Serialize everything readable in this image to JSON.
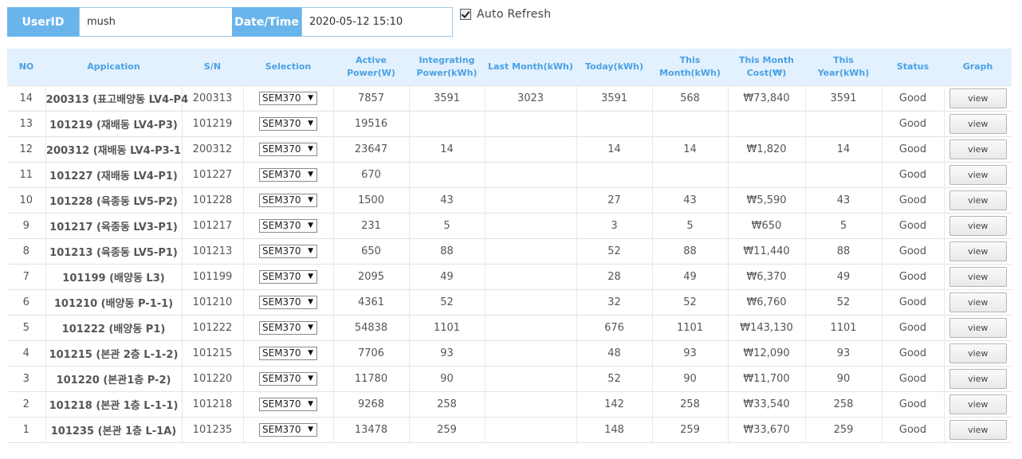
{
  "header": {
    "userid_label": "UserID",
    "userid_value": "mush",
    "datetime_label": "Date/Time",
    "datetime_value": "2020-05-12 15:10",
    "auto_refresh_label": "Auto Refresh",
    "auto_refresh_checked": true
  },
  "table": {
    "columns": [
      "NO",
      "Appication",
      "S/N",
      "Selection",
      "Active Power(W)",
      "Integrating Power(kWh)",
      "Last Month(kWh)",
      "Today(kWh)",
      "This Month(kWh)",
      "This Month Cost(₩)",
      "This Year(kWh)",
      "Status",
      "Graph"
    ],
    "view_label": "view",
    "rows": [
      {
        "no": "14",
        "app": "200313 (표고배양동 LV4-P4",
        "sn": "200313",
        "sel": "SEM370",
        "active": "7857",
        "integ": "3591",
        "lastm": "3023",
        "today": "3591",
        "month": "568",
        "cost": "₩73,840",
        "year": "3591",
        "status": "Good"
      },
      {
        "no": "13",
        "app": "101219 (재배동 LV4-P3)",
        "sn": "101219",
        "sel": "SEM370",
        "active": "19516",
        "integ": "",
        "lastm": "",
        "today": "",
        "month": "",
        "cost": "",
        "year": "",
        "status": "Good"
      },
      {
        "no": "12",
        "app": "200312 (재배동 LV4-P3-1",
        "sn": "200312",
        "sel": "SEM370",
        "active": "23647",
        "integ": "14",
        "lastm": "",
        "today": "14",
        "month": "14",
        "cost": "₩1,820",
        "year": "14",
        "status": "Good"
      },
      {
        "no": "11",
        "app": "101227 (재배동 LV4-P1)",
        "sn": "101227",
        "sel": "SEM370",
        "active": "670",
        "integ": "",
        "lastm": "",
        "today": "",
        "month": "",
        "cost": "",
        "year": "",
        "status": "Good"
      },
      {
        "no": "10",
        "app": "101228 (육종동 LV5-P2)",
        "sn": "101228",
        "sel": "SEM370",
        "active": "1500",
        "integ": "43",
        "lastm": "",
        "today": "27",
        "month": "43",
        "cost": "₩5,590",
        "year": "43",
        "status": "Good"
      },
      {
        "no": "9",
        "app": "101217 (육종동 LV3-P1)",
        "sn": "101217",
        "sel": "SEM370",
        "active": "231",
        "integ": "5",
        "lastm": "",
        "today": "3",
        "month": "5",
        "cost": "₩650",
        "year": "5",
        "status": "Good"
      },
      {
        "no": "8",
        "app": "101213 (육종동 LV5-P1)",
        "sn": "101213",
        "sel": "SEM370",
        "active": "650",
        "integ": "88",
        "lastm": "",
        "today": "52",
        "month": "88",
        "cost": "₩11,440",
        "year": "88",
        "status": "Good"
      },
      {
        "no": "7",
        "app": "101199 (배양동 L3)",
        "sn": "101199",
        "sel": "SEM370",
        "active": "2095",
        "integ": "49",
        "lastm": "",
        "today": "28",
        "month": "49",
        "cost": "₩6,370",
        "year": "49",
        "status": "Good"
      },
      {
        "no": "6",
        "app": "101210 (배양동 P-1-1)",
        "sn": "101210",
        "sel": "SEM370",
        "active": "4361",
        "integ": "52",
        "lastm": "",
        "today": "32",
        "month": "52",
        "cost": "₩6,760",
        "year": "52",
        "status": "Good"
      },
      {
        "no": "5",
        "app": "101222 (배양동 P1)",
        "sn": "101222",
        "sel": "SEM370",
        "active": "54838",
        "integ": "1101",
        "lastm": "",
        "today": "676",
        "month": "1101",
        "cost": "₩143,130",
        "year": "1101",
        "status": "Good"
      },
      {
        "no": "4",
        "app": "101215 (본관 2층 L-1-2)",
        "sn": "101215",
        "sel": "SEM370",
        "active": "7706",
        "integ": "93",
        "lastm": "",
        "today": "48",
        "month": "93",
        "cost": "₩12,090",
        "year": "93",
        "status": "Good"
      },
      {
        "no": "3",
        "app": "101220 (본관1층 P-2)",
        "sn": "101220",
        "sel": "SEM370",
        "active": "11780",
        "integ": "90",
        "lastm": "",
        "today": "52",
        "month": "90",
        "cost": "₩11,700",
        "year": "90",
        "status": "Good"
      },
      {
        "no": "2",
        "app": "101218 (본관 1층 L-1-1)",
        "sn": "101218",
        "sel": "SEM370",
        "active": "9268",
        "integ": "258",
        "lastm": "",
        "today": "142",
        "month": "258",
        "cost": "₩33,540",
        "year": "258",
        "status": "Good"
      },
      {
        "no": "1",
        "app": "101235 (본관 1층 L-1A)",
        "sn": "101235",
        "sel": "SEM370",
        "active": "13478",
        "integ": "259",
        "lastm": "",
        "today": "148",
        "month": "259",
        "cost": "₩33,670",
        "year": "259",
        "status": "Good"
      }
    ]
  }
}
